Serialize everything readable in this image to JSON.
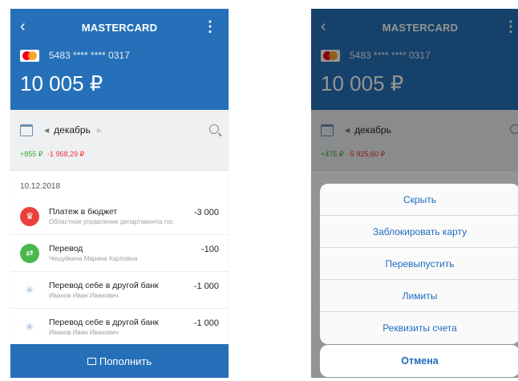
{
  "nav": {
    "back_icon": "chevron-left-icon",
    "title": "MASTERCARD",
    "more_icon": "more-vertical-icon"
  },
  "card": {
    "number": "5483 **** **** 0317",
    "balance": "10 005 ₽",
    "logo_icon": "mastercard-logo-icon"
  },
  "filter": {
    "month": "декабрь",
    "calendar_icon": "calendar-icon",
    "search_icon": "search-icon"
  },
  "left": {
    "income": "+855 ₽",
    "expense": "-1 968,29 ₽",
    "date": "10.12.2018",
    "transactions": [
      {
        "title": "Платеж в бюджет",
        "subtitle": "Областное управление департамента гос",
        "amount": "-3 000",
        "icon": "crown-icon",
        "color": "#e9423c"
      },
      {
        "title": "Перевод",
        "subtitle": "Чешуйкина Марина Карповна",
        "amount": "-100",
        "icon": "transfer-icon",
        "color": "#49b84d"
      },
      {
        "title": "Перевод себе в другой банк",
        "subtitle": "Иванов Иван Иванович",
        "amount": "-1 000",
        "icon": "loading-spinner-icon"
      },
      {
        "title": "Перевод себе в другой банк",
        "subtitle": "Иванов Иван Иванович",
        "amount": "-1 000",
        "icon": "loading-spinner-icon"
      }
    ],
    "topup_label": "Пополнить",
    "topup_icon": "card-icon"
  },
  "right": {
    "income": "+475 ₽",
    "expense": "-5 925,60 ₽",
    "sheet_items": [
      "Скрыть",
      "Заблокировать карту",
      "Перевыпустить",
      "Лимиты",
      "Реквизиты счета"
    ],
    "cancel_label": "Отмена"
  },
  "colors": {
    "primary": "#2570b9",
    "income": "#3aaa35",
    "expense": "#e33333",
    "link": "#1f6cc0"
  }
}
